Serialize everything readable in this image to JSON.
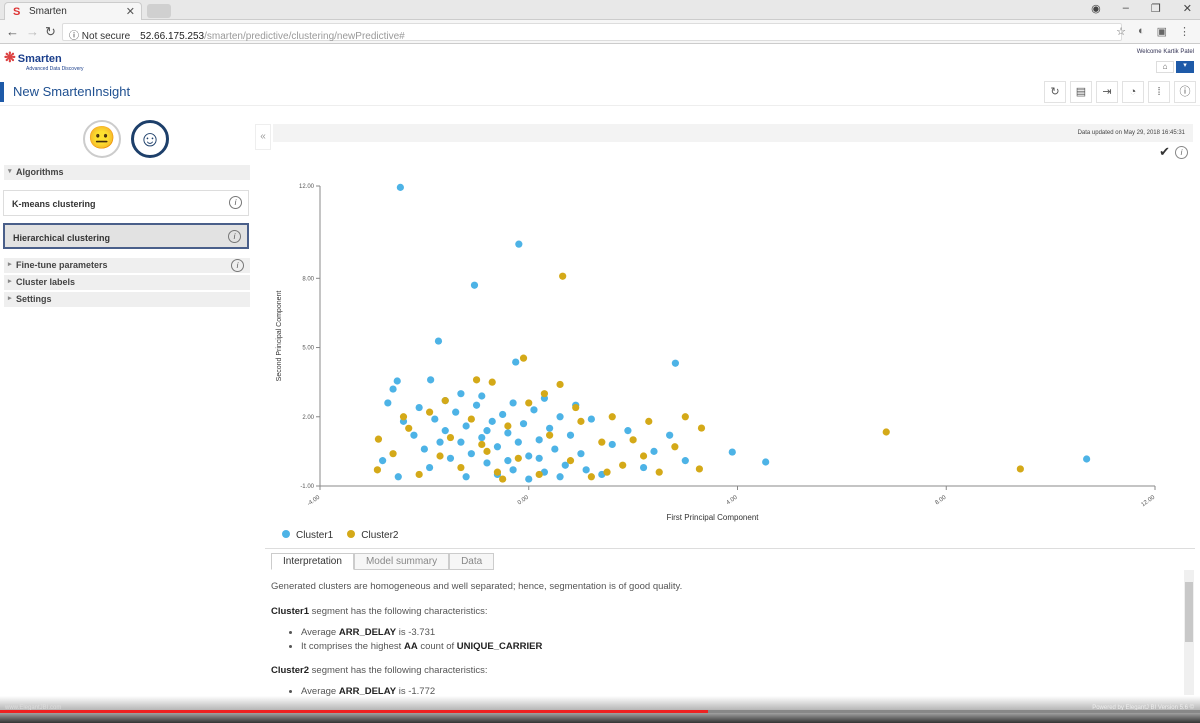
{
  "browser": {
    "tab_title": "Smarten",
    "security": "Not secure",
    "url_host": "52.66.175.253",
    "url_path": "/smarten/predictive/clustering/newPredictive#"
  },
  "app": {
    "logo": "Smarten",
    "logo_sub": "Advanced Data Discovery",
    "welcome": "Welcome Kartik Patel",
    "title": "New SmartenInsight"
  },
  "left": {
    "algorithms_header": "Algorithms",
    "algorithms": [
      {
        "label": "K-means clustering",
        "selected": false
      },
      {
        "label": "Hierarchical clustering",
        "selected": true
      }
    ],
    "sections": [
      "Fine-tune parameters",
      "Cluster labels",
      "Settings"
    ]
  },
  "status": {
    "data_updated": "Data updated on  May 29, 2018 16:45:31"
  },
  "chart_data": {
    "type": "scatter",
    "xlabel": "First Principal Component",
    "ylabel": "Second Principal Component",
    "xlim": [
      -4,
      12
    ],
    "ylim": [
      -1,
      12
    ],
    "xticks": [
      "-4.00",
      "0.00",
      "4.00",
      "8.00",
      "12.00"
    ],
    "xtick_values": [
      -4,
      0,
      4,
      8,
      12
    ],
    "yticks": [
      "-1.00",
      "2.00",
      "5.00",
      "8.00",
      "12.00"
    ],
    "ytick_values": [
      -1,
      2,
      5,
      8,
      12
    ],
    "legend_position": "bottom-left",
    "series": [
      {
        "name": "Cluster1",
        "color": "#4db3e6",
        "points": [
          [
            -2.46,
            11.94
          ],
          [
            -0.19,
            9.48
          ],
          [
            -1.04,
            7.7
          ],
          [
            -1.73,
            5.28
          ],
          [
            -0.25,
            4.37
          ],
          [
            2.81,
            4.32
          ],
          [
            10.69,
            0.17
          ],
          [
            4.54,
            0.04
          ],
          [
            3.9,
            0.47
          ],
          [
            -2.52,
            3.55
          ],
          [
            -1.88,
            3.6
          ],
          [
            -2.6,
            3.2
          ],
          [
            -2.7,
            2.6
          ],
          [
            -2.4,
            1.8
          ],
          [
            -2.2,
            1.2
          ],
          [
            -2.0,
            0.6
          ],
          [
            -1.8,
            1.9
          ],
          [
            -1.6,
            1.4
          ],
          [
            -1.5,
            0.2
          ],
          [
            -1.4,
            2.2
          ],
          [
            -1.3,
            0.9
          ],
          [
            -1.2,
            1.6
          ],
          [
            -1.1,
            0.4
          ],
          [
            -1.0,
            2.5
          ],
          [
            -0.9,
            1.1
          ],
          [
            -0.8,
            0.0
          ],
          [
            -0.7,
            1.8
          ],
          [
            -0.6,
            0.7
          ],
          [
            -0.5,
            2.1
          ],
          [
            -0.4,
            1.3
          ],
          [
            -0.3,
            -0.3
          ],
          [
            -0.2,
            0.9
          ],
          [
            -0.1,
            1.7
          ],
          [
            0.0,
            0.3
          ],
          [
            0.1,
            2.3
          ],
          [
            0.2,
            1.0
          ],
          [
            0.3,
            -0.4
          ],
          [
            0.4,
            1.5
          ],
          [
            0.5,
            0.6
          ],
          [
            0.6,
            2.0
          ],
          [
            0.7,
            -0.1
          ],
          [
            0.8,
            1.2
          ],
          [
            1.0,
            0.4
          ],
          [
            1.2,
            1.9
          ],
          [
            1.4,
            -0.5
          ],
          [
            1.6,
            0.8
          ],
          [
            1.9,
            1.4
          ],
          [
            2.2,
            -0.2
          ],
          [
            2.4,
            0.5
          ],
          [
            2.7,
            1.2
          ],
          [
            3.0,
            0.1
          ],
          [
            -2.8,
            0.1
          ],
          [
            -2.5,
            -0.6
          ],
          [
            -1.9,
            -0.2
          ],
          [
            -1.6,
            2.7
          ],
          [
            -1.2,
            -0.6
          ],
          [
            -0.9,
            2.9
          ],
          [
            -0.6,
            -0.5
          ],
          [
            -0.3,
            2.6
          ],
          [
            0.0,
            -0.7
          ],
          [
            0.3,
            2.8
          ],
          [
            0.6,
            -0.6
          ],
          [
            -2.1,
            2.4
          ],
          [
            -1.3,
            3.0
          ],
          [
            0.9,
            2.5
          ],
          [
            1.1,
            -0.3
          ],
          [
            -0.4,
            0.1
          ],
          [
            -1.7,
            0.9
          ],
          [
            -0.8,
            1.4
          ],
          [
            0.2,
            0.2
          ]
        ]
      },
      {
        "name": "Cluster2",
        "color": "#d4a918",
        "points": [
          [
            0.65,
            8.09
          ],
          [
            -0.1,
            4.54
          ],
          [
            6.85,
            1.34
          ],
          [
            9.42,
            -0.26
          ],
          [
            3.31,
            1.51
          ],
          [
            3.27,
            -0.26
          ],
          [
            -2.88,
            1.03
          ],
          [
            -2.9,
            -0.3
          ],
          [
            -2.6,
            0.4
          ],
          [
            -2.3,
            1.5
          ],
          [
            -2.1,
            -0.5
          ],
          [
            -1.9,
            2.2
          ],
          [
            -1.7,
            0.3
          ],
          [
            -1.5,
            1.1
          ],
          [
            -1.3,
            -0.2
          ],
          [
            -1.1,
            1.9
          ],
          [
            -0.9,
            0.8
          ],
          [
            -0.7,
            3.5
          ],
          [
            -0.6,
            -0.4
          ],
          [
            -0.4,
            1.6
          ],
          [
            -0.2,
            0.2
          ],
          [
            0.0,
            2.6
          ],
          [
            0.2,
            -0.5
          ],
          [
            0.4,
            1.2
          ],
          [
            0.6,
            3.4
          ],
          [
            0.8,
            0.1
          ],
          [
            1.0,
            1.8
          ],
          [
            1.2,
            -0.6
          ],
          [
            1.4,
            0.9
          ],
          [
            1.6,
            2.0
          ],
          [
            1.8,
            -0.1
          ],
          [
            2.0,
            1.0
          ],
          [
            2.3,
            1.8
          ],
          [
            2.5,
            -0.4
          ],
          [
            2.8,
            0.7
          ],
          [
            3.0,
            2.0
          ],
          [
            -1.0,
            3.6
          ],
          [
            -0.5,
            -0.7
          ],
          [
            0.3,
            3.0
          ],
          [
            -1.6,
            2.7
          ],
          [
            -2.4,
            2.0
          ],
          [
            1.5,
            -0.4
          ],
          [
            2.2,
            0.3
          ],
          [
            -0.8,
            0.5
          ],
          [
            0.9,
            2.4
          ]
        ]
      }
    ]
  },
  "tabs": [
    {
      "label": "Interpretation",
      "active": true
    },
    {
      "label": "Model summary",
      "active": false
    },
    {
      "label": "Data",
      "active": false
    }
  ],
  "interpretation": {
    "summary": "Generated clusters are homogeneous and well separated; hence, segmentation is of good quality.",
    "c1_name": "Cluster1",
    "c1_rest": " segment has the following characteristics:",
    "c1_b1_pre": "Average ",
    "c1_b1_var": "ARR_DELAY",
    "c1_b1_post": " is -3.731",
    "c1_b2_pre": "It comprises the highest ",
    "c1_b2_val": "AA",
    "c1_b2_mid": " count of ",
    "c1_b2_var": "UNIQUE_CARRIER",
    "c2_name": "Cluster2",
    "c2_rest": " segment has the following characteristics:",
    "c2_b1_pre": "Average ",
    "c2_b1_var": "ARR_DELAY",
    "c2_b1_post": " is -1.772"
  },
  "footer": {
    "link": "www.ElegantJBI.com",
    "powered": "Powered by ElegantJ BI Version 5.6 ©"
  },
  "video": {
    "progress": 0.59
  }
}
